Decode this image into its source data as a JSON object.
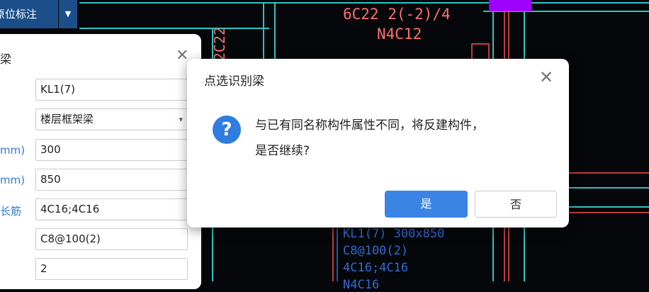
{
  "toolbar": {
    "label": "原位标注",
    "dropdown_icon": "caret-down-icon"
  },
  "cad": {
    "annotation_top": "6C22 2(-2)/4",
    "annotation_second": "N4C12",
    "vertical_text": "2C22",
    "beam_lines": [
      "KL1(7) 300x850",
      "C8@100(2)",
      "4C16;4C16",
      "N4C16"
    ]
  },
  "panel": {
    "title": "梁",
    "labels": [
      "mm)",
      "mm)",
      "长筋"
    ],
    "fields": [
      "KL1(7)",
      "楼层框架梁",
      "300",
      "850",
      "4C16;4C16",
      "C8@100(2)",
      "2"
    ]
  },
  "dialog": {
    "title": "点选识别梁",
    "message_line1": "与已有同名称构件属性不同，将反建构件，",
    "message_line2": "是否继续?",
    "yes_label": "是",
    "no_label": "否",
    "icon_glyph": "?"
  },
  "colors": {
    "accent_blue": "#3a84e6",
    "cad_cyan": "#2ec4c4",
    "cad_red": "#ff5050",
    "cad_magenta": "#a000ff"
  }
}
